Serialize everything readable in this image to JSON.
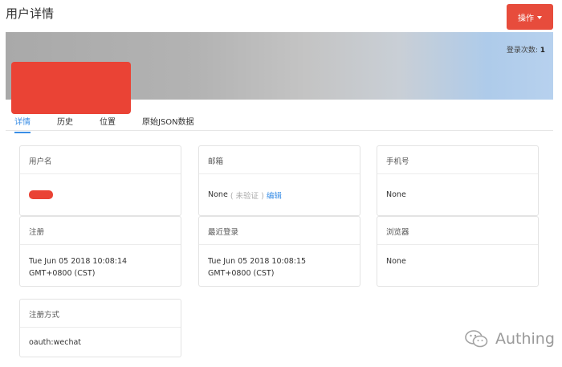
{
  "header": {
    "title": "用户详情",
    "actions_label": "操作"
  },
  "banner": {
    "login_label": "登录次数:",
    "login_count": "1"
  },
  "tabs": [
    {
      "label": "详情"
    },
    {
      "label": "历史"
    },
    {
      "label": "位置"
    },
    {
      "label": "原始JSON数据"
    }
  ],
  "cards": {
    "username": {
      "label": "用户名",
      "value": ""
    },
    "email": {
      "label": "邮箱",
      "value": "None",
      "status": "( 未验证 )",
      "edit": "编辑"
    },
    "phone": {
      "label": "手机号",
      "value": "None"
    },
    "registered": {
      "label": "注册",
      "value": "Tue Jun 05 2018 10:08:14 GMT+0800 (CST)"
    },
    "last_login": {
      "label": "最近登录",
      "value": "Tue Jun 05 2018 10:08:15 GMT+0800 (CST)"
    },
    "browser": {
      "label": "浏览器",
      "value": "None"
    },
    "register_method": {
      "label": "注册方式",
      "value": "oauth:wechat"
    }
  },
  "watermark": {
    "text": "Authing"
  },
  "colors": {
    "accent": "#3a8ee6",
    "action_red": "#e74c3c",
    "redaction": "#ea4335"
  }
}
